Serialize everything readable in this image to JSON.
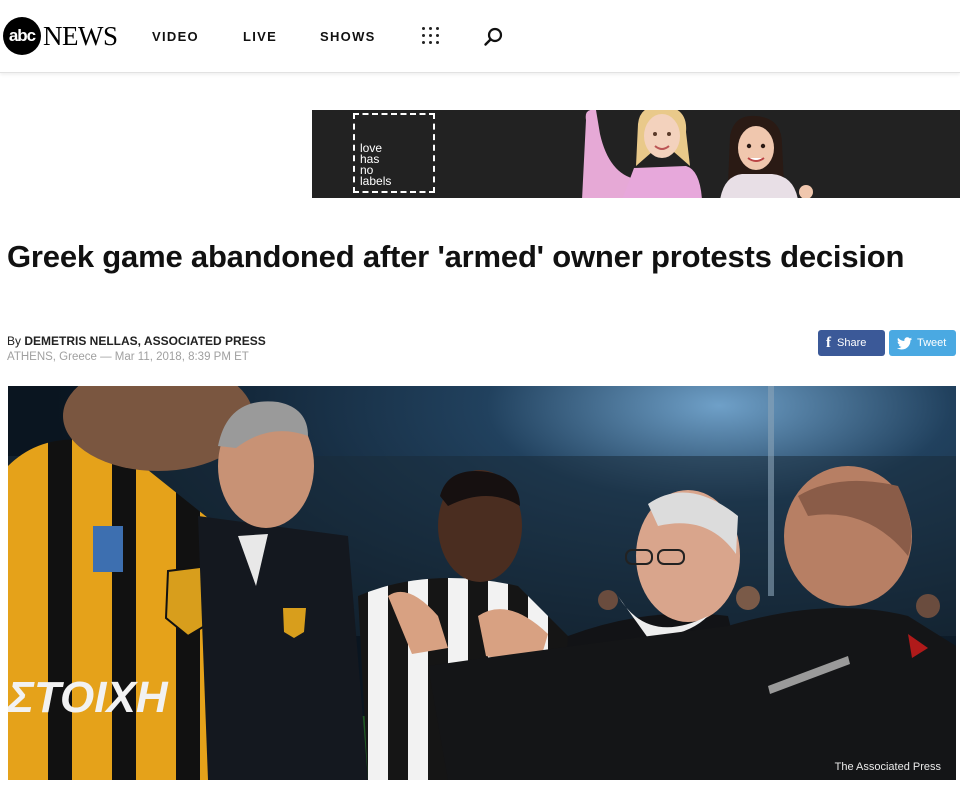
{
  "nav": {
    "logo_abc": "abc",
    "logo_news": "NEWS",
    "items": [
      {
        "label": "VIDEO"
      },
      {
        "label": "LIVE"
      },
      {
        "label": "SHOWS"
      }
    ],
    "menu_icon": "grid-dots-icon",
    "search_icon": "search-icon"
  },
  "ad": {
    "text_lines": [
      "love",
      "has",
      "no",
      "labels"
    ]
  },
  "article": {
    "headline": "Greek game abandoned after 'armed' owner protests decision",
    "byline_prefix": "By ",
    "author": "DEMETRIS NELLAS, ASSOCIATED PRESS",
    "dateline": "ATHENS, Greece — Mar 11, 2018, 8:39 PM ET",
    "photo_credit": "The Associated Press",
    "jersey_text": "ΣΤΟΙΧΗ"
  },
  "share": {
    "facebook_label": "Share",
    "twitter_label": "Tweet"
  },
  "colors": {
    "facebook": "#3b5998",
    "twitter": "#4aa9e2"
  }
}
